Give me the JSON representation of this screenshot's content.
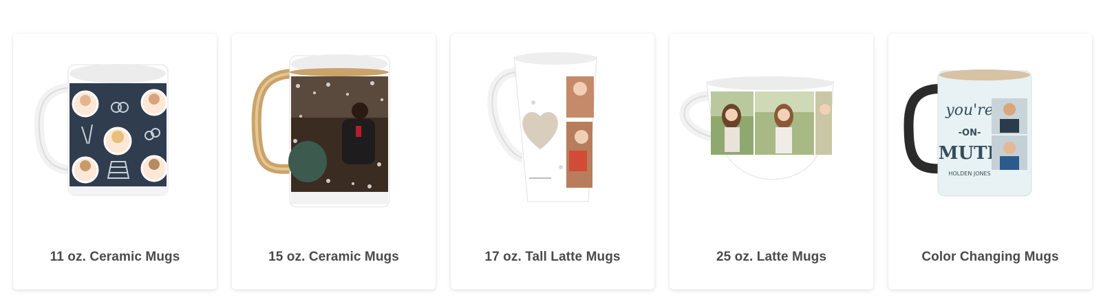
{
  "products": [
    {
      "label": "11 oz. Ceramic Mugs",
      "icon": "mug-11oz-icon"
    },
    {
      "label": "15 oz. Ceramic Mugs",
      "icon": "mug-15oz-icon"
    },
    {
      "label": "17 oz. Tall Latte Mugs",
      "icon": "mug-tall-latte-icon"
    },
    {
      "label": "25 oz. Latte Mugs",
      "icon": "mug-latte-bowl-icon"
    },
    {
      "label": "Color Changing Mugs",
      "icon": "mug-color-changing-icon"
    }
  ],
  "mug_texts": {
    "on_mute_line1": "you're",
    "on_mute_line2": "-ON-",
    "on_mute_line3": "MUTE",
    "on_mute_name": "HOLDEN JONES"
  },
  "colors": {
    "card_label": "#4a4a4a",
    "navy_wrap": "#2f3d4e",
    "gold_handle": "#c9a36a",
    "pale_blue_wrap": "#e8f1f3",
    "black_handle": "#2b2b2b"
  }
}
